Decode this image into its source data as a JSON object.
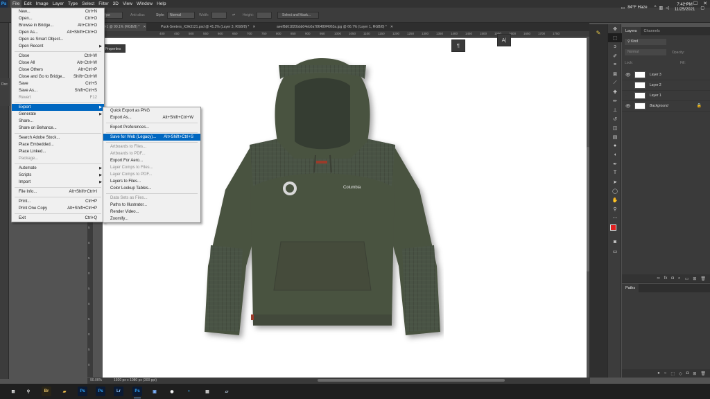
{
  "menubar": {
    "logo": "Ps",
    "items": [
      "File",
      "Edit",
      "Image",
      "Layer",
      "Type",
      "Select",
      "Filter",
      "3D",
      "View",
      "Window",
      "Help"
    ],
    "window_controls": [
      "—",
      "☐",
      "✕"
    ]
  },
  "options_bar": {
    "size_value": "0 px",
    "anti_alias": "Anti-alias",
    "style_label": "Style:",
    "style_value": "Normal",
    "width_label": "Width:",
    "height_label": "Height:",
    "select_mask": "Select and Mask..."
  },
  "tabs": [
    {
      "label": "d-1 @ 90.1% (RGB/8) *",
      "x": "✕"
    },
    {
      "label": "Puck-Seeters_X3A3121.psd @ 41.2% (Layer 3, RGB/8) *",
      "x": "✕"
    },
    {
      "label": "aeef8d61820bbb04eb0a786489f4963a.jpg @ 66.7% (Layer 1, RGB/8) *",
      "x": "✕"
    }
  ],
  "ruler": {
    "top": [
      "400",
      "450",
      "500",
      "550",
      "600",
      "650",
      "700",
      "750",
      "800",
      "850",
      "900",
      "950",
      "1000",
      "1050",
      "1100",
      "1150",
      "1200",
      "1250",
      "1300",
      "1350",
      "1400",
      "1450",
      "1500",
      "1550",
      "1600",
      "1650",
      "1700",
      "1750"
    ],
    "left": [
      "0",
      "5",
      "0",
      "5",
      "0",
      "5",
      "0",
      "5",
      "0",
      "5",
      "0",
      "5"
    ]
  },
  "file_menu": [
    {
      "label": "New...",
      "shortcut": "Ctrl+N"
    },
    {
      "label": "Open...",
      "shortcut": "Ctrl+O"
    },
    {
      "label": "Browse in Bridge...",
      "shortcut": "Alt+Ctrl+O"
    },
    {
      "label": "Open As...",
      "shortcut": "Alt+Shift+Ctrl+O"
    },
    {
      "label": "Open as Smart Object...",
      "shortcut": ""
    },
    {
      "label": "Open Recent",
      "shortcut": "",
      "submenu": true
    },
    {
      "sep": true
    },
    {
      "label": "Close",
      "shortcut": "Ctrl+W"
    },
    {
      "label": "Close All",
      "shortcut": "Alt+Ctrl+W"
    },
    {
      "label": "Close Others",
      "shortcut": "Alt+Ctrl+P"
    },
    {
      "label": "Close and Go to Bridge...",
      "shortcut": "Shift+Ctrl+W"
    },
    {
      "label": "Save",
      "shortcut": "Ctrl+S"
    },
    {
      "label": "Save As...",
      "shortcut": "Shift+Ctrl+S"
    },
    {
      "label": "Revert",
      "shortcut": "F12",
      "disabled": true
    },
    {
      "sep": true
    },
    {
      "label": "Export",
      "shortcut": "",
      "submenu": true,
      "highlighted": true
    },
    {
      "label": "Generate",
      "shortcut": "",
      "submenu": true
    },
    {
      "label": "Share...",
      "shortcut": ""
    },
    {
      "label": "Share on Behance...",
      "shortcut": ""
    },
    {
      "sep": true
    },
    {
      "label": "Search Adobe Stock...",
      "shortcut": ""
    },
    {
      "label": "Place Embedded...",
      "shortcut": ""
    },
    {
      "label": "Place Linked...",
      "shortcut": ""
    },
    {
      "label": "Package...",
      "shortcut": "",
      "disabled": true
    },
    {
      "sep": true
    },
    {
      "label": "Automate",
      "shortcut": "",
      "submenu": true
    },
    {
      "label": "Scripts",
      "shortcut": "",
      "submenu": true
    },
    {
      "label": "Import",
      "shortcut": "",
      "submenu": true
    },
    {
      "sep": true
    },
    {
      "label": "File Info...",
      "shortcut": "Alt+Shift+Ctrl+I"
    },
    {
      "sep": true
    },
    {
      "label": "Print...",
      "shortcut": "Ctrl+P"
    },
    {
      "label": "Print One Copy",
      "shortcut": "Alt+Shift+Ctrl+P"
    },
    {
      "sep": true
    },
    {
      "label": "Exit",
      "shortcut": "Ctrl+Q"
    }
  ],
  "export_menu": [
    {
      "label": "Quick Export as PNG",
      "shortcut": ""
    },
    {
      "label": "Export As...",
      "shortcut": "Alt+Shift+Ctrl+W"
    },
    {
      "sep": true
    },
    {
      "label": "Export Preferences...",
      "shortcut": ""
    },
    {
      "sep": true
    },
    {
      "label": "Save for Web (Legacy)...",
      "shortcut": "Alt+Shift+Ctrl+S",
      "highlighted": true
    },
    {
      "sep": true
    },
    {
      "label": "Artboards to Files...",
      "shortcut": "",
      "disabled": true
    },
    {
      "label": "Artboards to PDF...",
      "shortcut": "",
      "disabled": true
    },
    {
      "label": "Export For Aero...",
      "shortcut": ""
    },
    {
      "label": "Layer Comps to Files...",
      "shortcut": "",
      "disabled": true
    },
    {
      "label": "Layer Comps to PDF...",
      "shortcut": "",
      "disabled": true
    },
    {
      "label": "Layers to Files...",
      "shortcut": ""
    },
    {
      "label": "Color Lookup Tables...",
      "shortcut": ""
    },
    {
      "sep": true
    },
    {
      "label": "Data Sets as Files...",
      "shortcut": "",
      "disabled": true
    },
    {
      "label": "Paths to Illustrator...",
      "shortcut": ""
    },
    {
      "label": "Render Video...",
      "shortcut": ""
    },
    {
      "label": "Zoomify...",
      "shortcut": ""
    }
  ],
  "left_panel": {
    "properties_tab": "Properties",
    "doc_label": "Doc"
  },
  "floating": {
    "paragraph_icon": "¶",
    "character_icon": "A|"
  },
  "hoodie_brand": "Columbia",
  "statusbar": {
    "zoom": "90.06%",
    "doc_size": "1920 px x 1080 px (300 ppi)"
  },
  "layers_panel": {
    "tabs": [
      "Layers",
      "Channels"
    ],
    "kind": "Kind",
    "blend": "Normal",
    "opacity_label": "Opacity:",
    "fill_label": "Fill:",
    "lock_label": "Lock:",
    "layers": [
      {
        "name": "Layer 3",
        "visible": true
      },
      {
        "name": "Layer 2",
        "visible": false
      },
      {
        "name": "Layer 1",
        "visible": false
      },
      {
        "name": "Background",
        "visible": true,
        "locked": true
      }
    ]
  },
  "paths_panel": {
    "title": "Paths"
  },
  "taskbar": {
    "apps": [
      {
        "name": "windows-start",
        "glyph": "⊞",
        "color": "#ffffff",
        "bg": "transparent"
      },
      {
        "name": "search",
        "glyph": "⚲",
        "color": "#ffffff",
        "bg": "transparent"
      },
      {
        "name": "bridge",
        "glyph": "Br",
        "color": "#e9c46a",
        "bg": "#2a2517"
      },
      {
        "name": "file-explorer",
        "glyph": "▰",
        "color": "#f2c14e",
        "bg": "transparent"
      },
      {
        "name": "photoshop-a",
        "glyph": "Ps",
        "color": "#31a8ff",
        "bg": "#0b1a33"
      },
      {
        "name": "photoshop-b",
        "glyph": "Ps",
        "color": "#31a8ff",
        "bg": "#0b1a33"
      },
      {
        "name": "lightroom",
        "glyph": "Lr",
        "color": "#8ec8ff",
        "bg": "#0b1a33"
      },
      {
        "name": "photoshop-active",
        "glyph": "Ps",
        "color": "#31a8ff",
        "bg": "#0b1a33"
      },
      {
        "name": "photos",
        "glyph": "▣",
        "color": "#7fb3ff",
        "bg": "transparent"
      },
      {
        "name": "chrome-like",
        "glyph": "◉",
        "color": "#ffffff",
        "bg": "transparent"
      },
      {
        "name": "edge",
        "glyph": "◐",
        "color": "#3fb8ff",
        "bg": "transparent"
      },
      {
        "name": "calculator",
        "glyph": "▦",
        "color": "#d0d0d0",
        "bg": "transparent"
      },
      {
        "name": "notes",
        "glyph": "▱",
        "color": "#d0e8ff",
        "bg": "transparent"
      }
    ],
    "weather": "84°F  Haze",
    "time": "7:42 PM",
    "date": "11/25/2021"
  },
  "colors": {
    "menu_highlight": "#0067c0",
    "foreground_swatch": "#e02020",
    "background_swatch": "#000000",
    "hoodie_body": "#4a5240"
  }
}
